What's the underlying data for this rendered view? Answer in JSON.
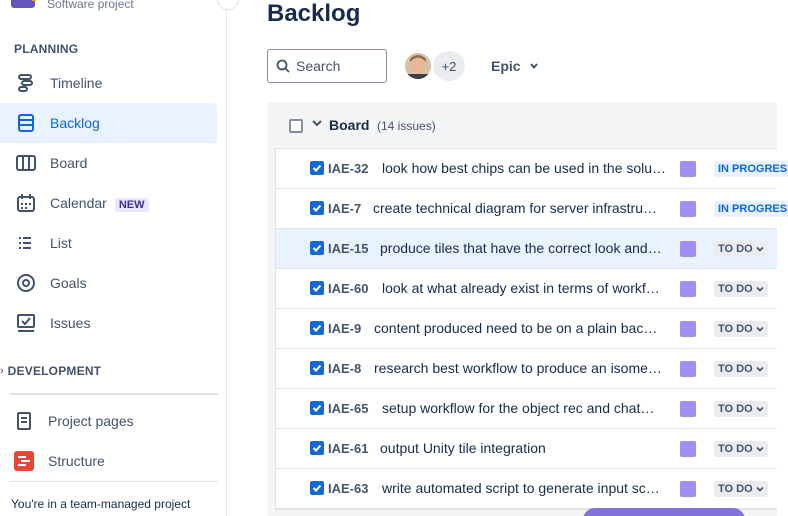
{
  "project": {
    "subtitle": "Software project"
  },
  "sidebar": {
    "planning_title": "PLANNING",
    "items": [
      {
        "label": "Timeline",
        "icon": "timeline-icon"
      },
      {
        "label": "Backlog",
        "icon": "backlog-icon",
        "active": true
      },
      {
        "label": "Board",
        "icon": "board-icon"
      },
      {
        "label": "Calendar",
        "icon": "calendar-icon",
        "badge": "NEW"
      },
      {
        "label": "List",
        "icon": "list-icon"
      },
      {
        "label": "Goals",
        "icon": "goals-icon"
      },
      {
        "label": "Issues",
        "icon": "issues-icon"
      }
    ],
    "development_title": "DEVELOPMENT",
    "extra_items": [
      {
        "label": "Project pages",
        "icon": "page-icon"
      },
      {
        "label": "Structure",
        "icon": "structure-icon"
      }
    ],
    "footer": "You're in a team-managed project"
  },
  "main": {
    "title": "Backlog",
    "search_placeholder": "Search",
    "avatar_more": "+2",
    "epic_label": "Epic",
    "board": {
      "title": "Board",
      "count": "(14 issues)",
      "issues": [
        {
          "key": "IAE-32",
          "summary": "look how best chips can be used in the solu…",
          "status": "IN PROGRESS"
        },
        {
          "key": "IAE-7",
          "summary": "create technical diagram for server infrastru…",
          "status": "IN PROGRESS"
        },
        {
          "key": "IAE-15",
          "summary": "produce tiles that have the correct look and…",
          "status": "TO DO"
        },
        {
          "key": "IAE-60",
          "summary": "look at what already exist in terms of workf…",
          "status": "TO DO"
        },
        {
          "key": "IAE-9",
          "summary": "content produced need to be on a plain bac…",
          "status": "TO DO"
        },
        {
          "key": "IAE-8",
          "summary": "research best workflow to produce an isome…",
          "status": "TO DO"
        },
        {
          "key": "IAE-65",
          "summary": "setup workflow for the object rec and chat…",
          "status": "TO DO"
        },
        {
          "key": "IAE-61",
          "summary": "output Unity tile integration",
          "status": "TO DO"
        },
        {
          "key": "IAE-63",
          "summary": "write automated script to generate input sc…",
          "status": "TO DO"
        }
      ]
    }
  },
  "colors": {
    "accent": "#0c66e4",
    "epic": "#a08ef2"
  }
}
